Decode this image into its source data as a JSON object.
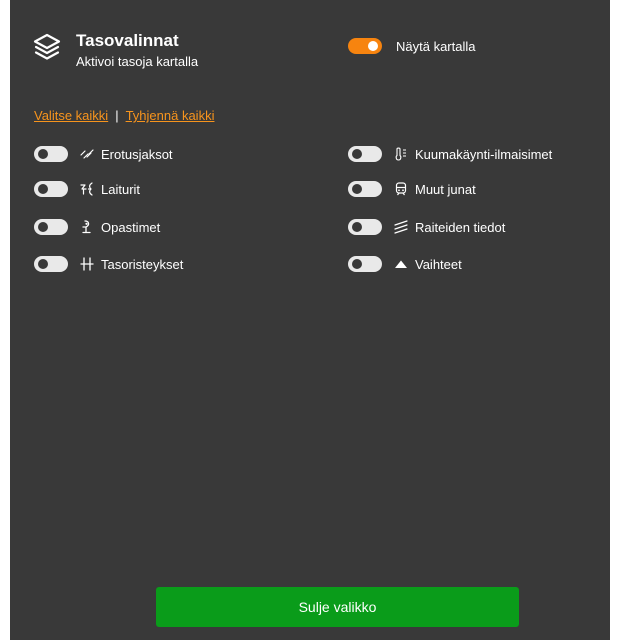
{
  "header": {
    "title": "Tasovalinnat",
    "subtitle": "Aktivoi tasoja kartalla",
    "icon": "layers-icon"
  },
  "show_on_map": {
    "label": "Näytä kartalla",
    "enabled": true,
    "accent_color": "#f7840f"
  },
  "selection": {
    "select_all": "Valitse kaikki",
    "separator": "|",
    "clear_all": "Tyhjennä kaikki",
    "link_color": "#f7941d"
  },
  "layers_left": [
    {
      "label": "Erotusjaksot",
      "icon": "separation-icon",
      "enabled": false
    },
    {
      "label": "Laiturit",
      "icon": "platform-icon",
      "enabled": false
    },
    {
      "label": "Opastimet",
      "icon": "signal-icon",
      "enabled": false
    },
    {
      "label": "Tasoristeykset",
      "icon": "level-crossing-icon",
      "enabled": false
    }
  ],
  "layers_right": [
    {
      "label": "Kuumakäynti-ilmaisimet",
      "icon": "thermometer-icon",
      "enabled": false
    },
    {
      "label": "Muut junat",
      "icon": "train-icon",
      "enabled": false
    },
    {
      "label": "Raiteiden tiedot",
      "icon": "track-info-icon",
      "enabled": false
    },
    {
      "label": "Vaihteet",
      "icon": "switch-icon",
      "enabled": false
    }
  ],
  "close_button": {
    "label": "Sulje valikko",
    "color": "#0a9c1a"
  },
  "panel_color": "#393939"
}
